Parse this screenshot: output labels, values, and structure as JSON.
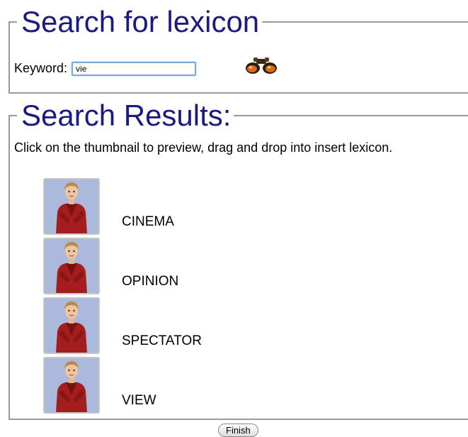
{
  "search_section": {
    "legend": "Search for lexicon",
    "keyword_label": "Keyword:",
    "keyword_value": "vie",
    "search_icon": "binoculars-icon"
  },
  "results_section": {
    "legend": "Search Results:",
    "instructions": "Click on the thumbnail to preview, drag and drop into insert lexicon.",
    "results": [
      {
        "label": "CINEMA"
      },
      {
        "label": "OPINION"
      },
      {
        "label": "SPECTATOR"
      },
      {
        "label": "VIEW"
      }
    ]
  },
  "footer": {
    "finish_label": "Finish"
  },
  "colors": {
    "legend_text": "#1a1a80",
    "thumbnail_bg": "#aab9dc",
    "avatar_shirt": "#a41e1e",
    "input_border": "#7aa7dd"
  }
}
